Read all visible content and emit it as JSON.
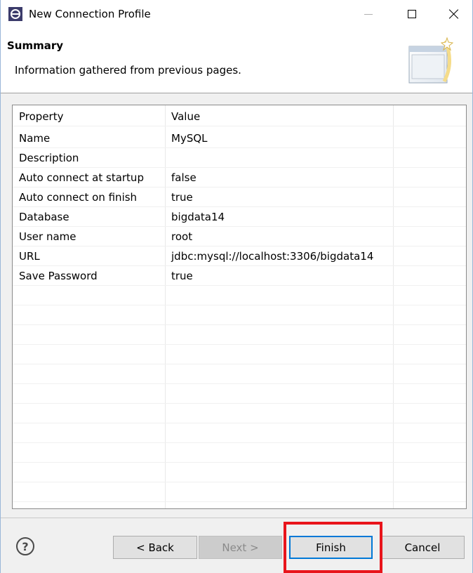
{
  "window": {
    "title": "New Connection Profile"
  },
  "header": {
    "title": "Summary",
    "description": "Information gathered from previous pages."
  },
  "table": {
    "columns": [
      "Property",
      "Value"
    ],
    "rows": [
      {
        "property": "Name",
        "value": "MySQL"
      },
      {
        "property": "Description",
        "value": ""
      },
      {
        "property": "Auto connect at startup",
        "value": "false"
      },
      {
        "property": "Auto connect on finish",
        "value": "true"
      },
      {
        "property": "Database",
        "value": "bigdata14"
      },
      {
        "property": "User name",
        "value": "root"
      },
      {
        "property": "URL",
        "value": "jdbc:mysql://localhost:3306/bigdata14"
      },
      {
        "property": "Save Password",
        "value": "true"
      }
    ]
  },
  "footer": {
    "help_label": "?",
    "back_label": "< Back",
    "next_label": "Next >",
    "finish_label": "Finish",
    "cancel_label": "Cancel"
  },
  "colors": {
    "highlight": "#e8141b",
    "focus_border": "#0078d7"
  }
}
